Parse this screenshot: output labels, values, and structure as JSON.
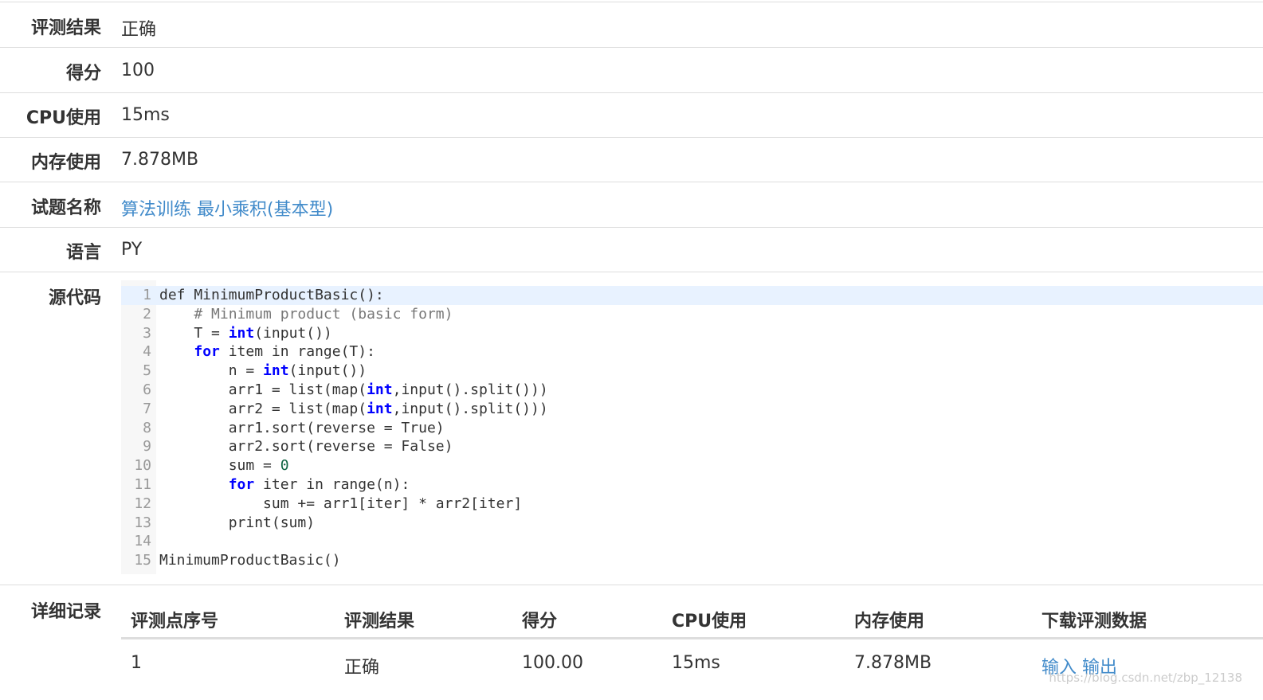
{
  "info": [
    {
      "label": "评测结果",
      "value": "正确"
    },
    {
      "label": "得分",
      "value": "100"
    },
    {
      "label": "CPU使用",
      "value": "15ms"
    },
    {
      "label": "内存使用",
      "value": "7.878MB"
    },
    {
      "label": "试题名称",
      "value": "算法训练 最小乘积(基本型)"
    },
    {
      "label": "语言",
      "value": "PY"
    }
  ],
  "source": {
    "label": "源代码",
    "lines": [
      "def MinimumProductBasic():",
      "    # Minimum product (basic form)",
      "    T = int(input())",
      "    for item in range(T):",
      "        n = int(input())",
      "        arr1 = list(map(int,input().split()))",
      "        arr2 = list(map(int,input().split()))",
      "        arr1.sort(reverse = True)",
      "        arr2.sort(reverse = False)",
      "        sum = 0",
      "        for iter in range(n):",
      "            sum += arr1[iter] * arr2[iter]",
      "        print(sum)",
      "",
      "MinimumProductBasic()"
    ]
  },
  "detail": {
    "label": "详细记录",
    "headers": [
      "评测点序号",
      "评测结果",
      "得分",
      "CPU使用",
      "内存使用",
      "下载评测数据"
    ],
    "rows": [
      {
        "index": "1",
        "result": "正确",
        "score": "100.00",
        "cpu": "15ms",
        "memory": "7.878MB",
        "input_link": "输入",
        "output_link": "输出"
      }
    ]
  },
  "watermark": "https://blog.csdn.net/zbp_12138",
  "colors": {
    "link": "#428bca",
    "border": "#dddddd",
    "keyword": "#0000ff",
    "highlight": "#e8f2ff"
  }
}
